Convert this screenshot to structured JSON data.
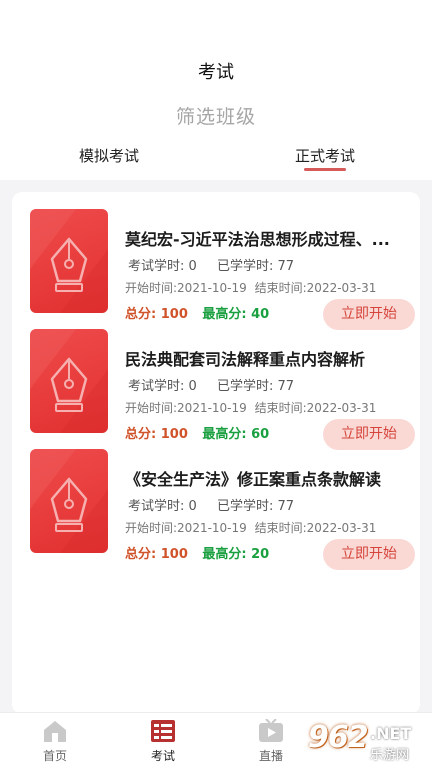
{
  "header": {
    "title": "考试",
    "filter_label": "筛选班级"
  },
  "tabs": [
    {
      "label": "模拟考试",
      "active": false
    },
    {
      "label": "正式考试",
      "active": true
    }
  ],
  "exam_labels": {
    "exam_hours": "考试学时:",
    "studied_hours": "已学学时:",
    "start_time": "开始时间:",
    "end_time": "结束时间:",
    "total_score": "总分:",
    "best_score": "最高分:",
    "start_button": "立即开始"
  },
  "exams": [
    {
      "title": "莫纪宏-习近平法治思想形成过程、...",
      "exam_hours": "0",
      "studied_hours": "77",
      "start_time": "2021-10-19",
      "end_time": "2022-03-31",
      "total_score": "100",
      "best_score": "40"
    },
    {
      "title": "民法典配套司法解释重点内容解析",
      "exam_hours": "0",
      "studied_hours": "77",
      "start_time": "2021-10-19",
      "end_time": "2022-03-31",
      "total_score": "100",
      "best_score": "60"
    },
    {
      "title": "《安全生产法》修正案重点条款解读",
      "exam_hours": "0",
      "studied_hours": "77",
      "start_time": "2021-10-19",
      "end_time": "2022-03-31",
      "total_score": "100",
      "best_score": "20"
    }
  ],
  "bottom_nav": [
    {
      "label": "首页",
      "icon": "home-icon",
      "active": false
    },
    {
      "label": "考试",
      "icon": "exam-list-icon",
      "active": true
    },
    {
      "label": "直播",
      "icon": "live-tv-icon",
      "active": false
    }
  ],
  "watermark": {
    "brand": "962",
    "suffix": ".NET",
    "subtitle": "乐游网"
  },
  "colors": {
    "accent": "#d65a5a",
    "thumb": "#e83a3a",
    "button_bg": "#fad9d5",
    "button_text": "#d6433a",
    "total_score": "#d0532a",
    "best_score": "#1aa040"
  }
}
